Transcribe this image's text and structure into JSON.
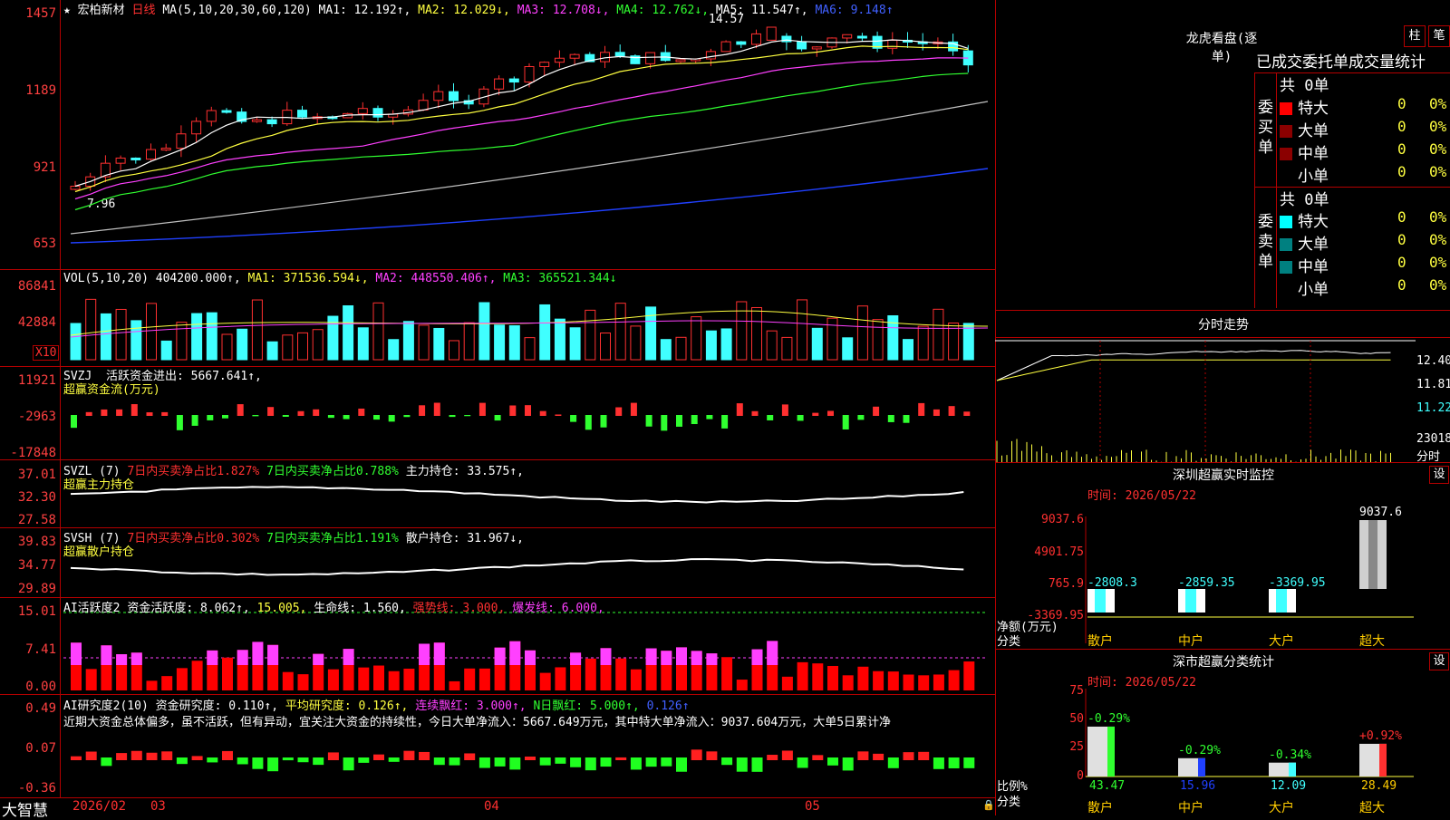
{
  "stock": {
    "star": "★",
    "name": "宏柏新材",
    "period": "日线"
  },
  "ma_legend": {
    "label": "MA(5,10,20,30,60,120)",
    "ma1": "MA1: 12.192↑,",
    "ma2": "MA2: 12.029↓,",
    "ma3": "MA3: 12.708↓,",
    "ma4": "MA4: 12.762↓,",
    "ma5": "MA5: 11.547↑,",
    "ma6": "MA6: 9.148↑"
  },
  "price_panel": {
    "y_labels": [
      "1457",
      "1189",
      "921",
      "653"
    ],
    "high_label": "14.57",
    "low_label": "7.96"
  },
  "vol_panel": {
    "legend": "VOL(5,10,20)",
    "vol": "404200.000↑,",
    "ma1": "MA1: 371536.594↓,",
    "ma2": "MA2: 448550.406↑,",
    "ma3": "MA3: 365521.344↓",
    "y_labels": [
      "86841",
      "42884"
    ],
    "unit": "X10"
  },
  "svzj_panel": {
    "name": "SVZJ",
    "legend": "活跃资金进出: 5667.641↑,",
    "sub": "超赢资金流(万元)",
    "y_labels": [
      "11921",
      "-2963",
      "-17848"
    ]
  },
  "svzl_panel": {
    "name": "SVZL (7)",
    "a": "7日内买卖净占比1.827%",
    "b": "7日内买卖净占比0.788%",
    "c": "主力持仓: 33.575↑,",
    "sub": "超赢主力持仓",
    "y_labels": [
      "37.01",
      "32.30",
      "27.58"
    ]
  },
  "svsh_panel": {
    "name": "SVSH (7)",
    "a": "7日内买卖净占比0.302%",
    "b": "7日内买卖净占比1.191%",
    "c": "散户持仓: 31.967↓,",
    "sub": "超赢散户持仓",
    "y_labels": [
      "39.83",
      "34.77",
      "29.89"
    ]
  },
  "ai_act_panel": {
    "name": "AI活跃度2",
    "a": "资金活跃度: 8.062↑,",
    "b": "15.005,",
    "c": "生命线: 1.560,",
    "d": "强势线: 3.000,",
    "e": "爆发线: 6.000,",
    "y_labels": [
      "15.01",
      "7.41",
      "0.00"
    ]
  },
  "ai_res_panel": {
    "name": "AI研究度2(10)",
    "a": "资金研究度: 0.110↑,",
    "b": "平均研究度: 0.126↑,",
    "c": "连续飘红: 3.000↑,",
    "d": "N日飘红: 5.000↑,",
    "e": "0.126↑",
    "comment": "近期大资金总体偏多，虽不活跃，但有异动，宜关注大资金的持续性，今日大单净流入：5667.649万元，其中特大单净流入：9037.604万元，大单5日累计净",
    "y_labels": [
      "0.49",
      "0.07",
      "-0.36"
    ]
  },
  "x_axis": {
    "labels": [
      "2026/02",
      "03",
      "04",
      "05"
    ]
  },
  "brand": "大智慧",
  "dragon": {
    "title": "龙虎看盘(逐单)",
    "btn_a": "柱",
    "btn_b": "笔",
    "tabs": "已成交委托单成交量统计",
    "buy_label": "委买单",
    "sell_label": "委卖单",
    "buy_total": "共 0单",
    "sell_total": "共 0单",
    "buy_rows": [
      {
        "name": "特大",
        "count": "0",
        "pct": "0%"
      },
      {
        "name": "大单",
        "count": "0",
        "pct": "0%"
      },
      {
        "name": "中单",
        "count": "0",
        "pct": "0%"
      },
      {
        "name": "小单",
        "count": "0",
        "pct": "0%"
      }
    ],
    "sell_rows": [
      {
        "name": "特大",
        "count": "0",
        "pct": "0%"
      },
      {
        "name": "大单",
        "count": "0",
        "pct": "0%"
      },
      {
        "name": "中单",
        "count": "0",
        "pct": "0%"
      },
      {
        "name": "小单",
        "count": "0",
        "pct": "0%"
      }
    ],
    "colors": {
      "buy": [
        "#ff0000",
        "#8b0000",
        "#8b0000",
        "#000000"
      ],
      "sell": [
        "#00ffff",
        "#008080",
        "#008080",
        "#000000"
      ]
    }
  },
  "intraday": {
    "title": "分时走势",
    "y_labels": [
      "12.40",
      "11.81",
      "11.22",
      "23018",
      "分时"
    ]
  },
  "monitor": {
    "title": "深圳超赢实时监控",
    "settings": "设",
    "time": "时间: 2026/05/22",
    "y_labels": [
      "9037.6",
      "4901.75",
      "765.9",
      "-3369.95"
    ],
    "ylabel_a": "净额(万元)",
    "ylabel_b": "分类",
    "categories": [
      "散户",
      "中户",
      "大户",
      "超大"
    ],
    "values": [
      "-2808.3",
      "-2859.35",
      "-3369.95",
      "9037.6"
    ]
  },
  "classify": {
    "title": "深市超赢分类统计",
    "settings": "设",
    "time": "时间: 2026/05/22",
    "y_labels": [
      "75",
      "50",
      "25",
      "0"
    ],
    "ylabel_a": "比例%",
    "ylabel_b": "分类",
    "categories": [
      "散户",
      "中户",
      "大户",
      "超大"
    ],
    "changes": [
      "-0.29%",
      "-0.29%",
      "-0.34%",
      "+0.92%"
    ],
    "values": [
      "43.47",
      "15.96",
      "12.09",
      "28.49"
    ]
  }
}
